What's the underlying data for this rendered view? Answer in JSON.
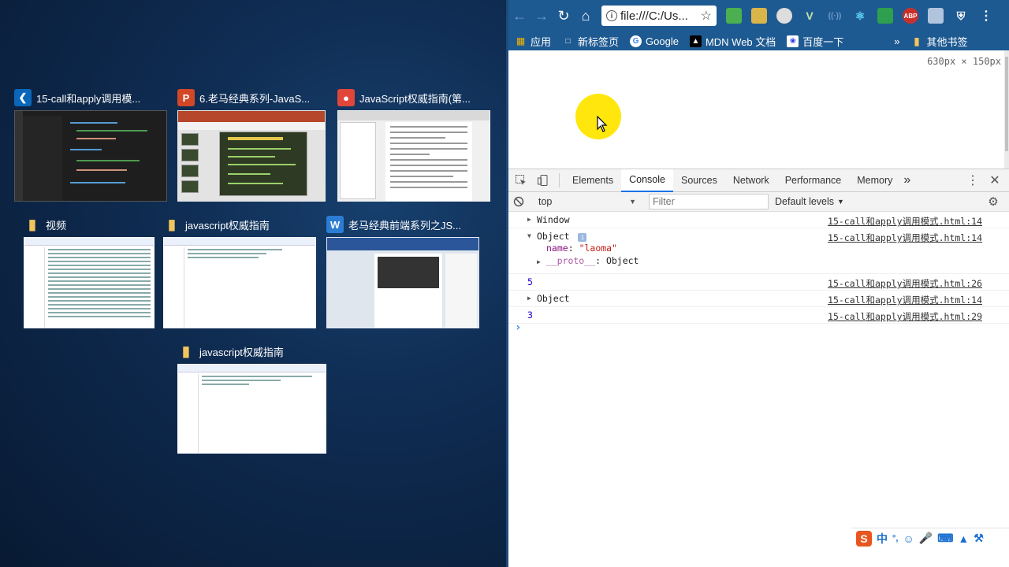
{
  "taskview": {
    "windows": [
      {
        "title": "15-call和apply调用模...",
        "icon": "vscode-icon",
        "icon_color": "#0a66b8"
      },
      {
        "title": "6.老马经典系列-JavaS...",
        "icon": "powerpoint-icon",
        "icon_color": "#d24726"
      },
      {
        "title": "JavaScript权威指南(第...",
        "icon": "pdf-reader-icon",
        "icon_color": "#e0463a"
      },
      {
        "title": "视频",
        "icon": "folder-icon",
        "icon_color": "#f2c55c"
      },
      {
        "title": "javascript权威指南",
        "icon": "folder-icon",
        "icon_color": "#f2c55c"
      },
      {
        "title": "老马经典前端系列之JS...",
        "icon": "word-icon",
        "icon_color": "#2b7cd3"
      },
      {
        "title": "javascript权威指南",
        "icon": "folder-icon",
        "icon_color": "#f2c55c"
      }
    ]
  },
  "browser": {
    "url": "file:///C:/Us...",
    "bookmarks": [
      {
        "label": "应用",
        "icon": "apps-grid-icon"
      },
      {
        "label": "新标签页",
        "icon": "page-icon"
      },
      {
        "label": "Google",
        "icon": "google-icon"
      },
      {
        "label": "MDN Web 文档",
        "icon": "mdn-icon"
      },
      {
        "label": "百度一下",
        "icon": "baidu-icon"
      }
    ],
    "bookmarks_overflow": "»",
    "other_bookmarks": "其他书签",
    "viewport_size": "630px × 150px"
  },
  "devtools": {
    "tabs": [
      "Elements",
      "Console",
      "Sources",
      "Network",
      "Performance",
      "Memory"
    ],
    "active_tab": "Console",
    "more_tabs": "»",
    "context": "top",
    "filter_placeholder": "Filter",
    "levels": "Default levels",
    "messages": [
      {
        "type": "collapsed",
        "text": "Window",
        "source": "15-call和apply调用模式.html:14"
      },
      {
        "type": "expanded",
        "text": "Object",
        "source": "15-call和apply调用模式.html:14",
        "props": [
          {
            "key": "name",
            "value": "\"laoma\""
          },
          {
            "key": "__proto__",
            "value": "Object"
          }
        ]
      },
      {
        "type": "value",
        "text": "5",
        "source": "15-call和apply调用模式.html:26"
      },
      {
        "type": "collapsed",
        "text": "Object",
        "source": "15-call和apply调用模式.html:14"
      },
      {
        "type": "value",
        "text": "3",
        "source": "15-call和apply调用模式.html:29"
      }
    ],
    "prompt": "›"
  },
  "ime": {
    "label": "中",
    "punct": "°,"
  },
  "colors": {
    "browser_toolbar": "#1e5a92",
    "cursor_highlight": "#ffe600",
    "active_tab_underline": "#1a73e8"
  }
}
